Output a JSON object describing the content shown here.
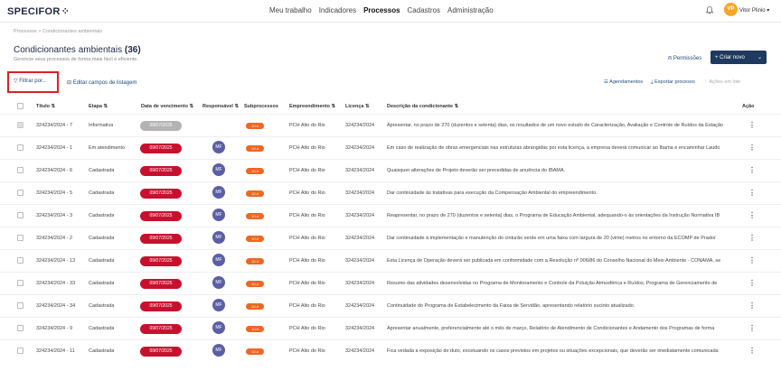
{
  "app": {
    "logo": "SPECIFOR",
    "logo_mark": "⁘"
  },
  "nav": {
    "items": [
      "Meu trabalho",
      "Indicadores",
      "Processos",
      "Cadastros",
      "Administração"
    ],
    "active": "Processos"
  },
  "user": {
    "initials": "VP",
    "name": "Vitor Plinio",
    "chevron": "▾",
    "bell_icon": "bell-icon"
  },
  "breadcrumb": "Processos  >  Condicionantes ambientais",
  "page": {
    "title": "Condicionantes ambientais",
    "count": "(36)",
    "subtitle": "Gerencie seus processos de forma mais fácil e eficiente."
  },
  "actions": {
    "permissions": "Permissões",
    "new_button": "+  Criar novo",
    "new_chevron": "⌄",
    "filter": "Filtrar por...",
    "edit_columns": "Editar campos de listagem",
    "schedules": "Agendamentos",
    "export": "Exportar processo",
    "bulk": "Ações em lote"
  },
  "columns": {
    "title": "Título",
    "stage": "Etapa",
    "due": "Data de vencimento",
    "responsible": "Responsável",
    "subprocesses": "Subprocessos",
    "project": "Empreendimento",
    "license": "Licença",
    "description": "Descrição da condicionante",
    "action": "Ação"
  },
  "sort_icon": "⇅",
  "rows": [
    {
      "title": "324234/2024 - 7",
      "stage": "Informativa",
      "date": "09/07/2025",
      "avatar": "",
      "sub": "10 d",
      "project": "PCH Alto do Rio",
      "license": "324234/2024",
      "desc": "Apresentar, no prazo de 270 (duzentos e setenta) dias, os resultados de um novo estudo de Caracterização, Avaliação e Controle de Ruídos da Estação"
    },
    {
      "title": "324234/2024 - 1",
      "stage": "Em atendimento",
      "date": "09/07/2025",
      "avatar": "MF",
      "sub": "10 d",
      "project": "PCH Alto do Rio",
      "license": "324234/2024",
      "desc": "Em caso de realização de obras emergenciais nas estruturas abrangidas por esta licença, a empresa deverá comunicar ao Ibama e encaminhar Laudo"
    },
    {
      "title": "324234/2024 - 6",
      "stage": "Cadastrada",
      "date": "09/07/2025",
      "avatar": "MF",
      "sub": "10 d",
      "project": "PCH Alto do Rio",
      "license": "324234/2024",
      "desc": "Quaisquer alterações de Projeto deverão ser precedidas de anuência do IBAMA."
    },
    {
      "title": "324234/2024 - 5",
      "stage": "Cadastrada",
      "date": "09/07/2025",
      "avatar": "MF",
      "sub": "10 d",
      "project": "PCH Alto do Rio",
      "license": "324234/2024",
      "desc": "Dar continuidade às tratativas para execução da Compensação Ambiental do empreendimento."
    },
    {
      "title": "324234/2024 - 3",
      "stage": "Cadastrada",
      "date": "09/07/2025",
      "avatar": "MF",
      "sub": "10 d",
      "project": "PCH Alto do Rio",
      "license": "324234/2024",
      "desc": "Reapresentar, no prazo de 270 (duzentos e setenta) dias, o Programa de Educação Ambiental, adequando-o às orientações da Instrução Normativa IB"
    },
    {
      "title": "324234/2024 - 2",
      "stage": "Cadastrada",
      "date": "09/07/2025",
      "avatar": "MF",
      "sub": "10 d",
      "project": "PCH Alto do Rio",
      "license": "324234/2024",
      "desc": "Dar continuidade à implementação e manutenção do cinturão verde em uma faixa com largura de 20 (vinte) metros no entorno da ECOMP de Prado/"
    },
    {
      "title": "324234/2024 - 13",
      "stage": "Cadastrada",
      "date": "09/07/2025",
      "avatar": "MF",
      "sub": "10 d",
      "project": "PCH Alto do Rio",
      "license": "324234/2024",
      "desc": "Esta Licença de Operação deverá ser publicada em conformidade com a Resolução nº 006/86 do Conselho Nacional do Meio Ambiente - CONAMA, se"
    },
    {
      "title": "324234/2024 - 33",
      "stage": "Cadastrada",
      "date": "09/07/2025",
      "avatar": "MF",
      "sub": "10 d",
      "project": "PCH Alto do Rio",
      "license": "324234/2024",
      "desc": "Resumo das atividades desenvolvidas no Programa de Monitoramento e Controle da Poluição Atmosférica e Ruídos, Programa de Gerenciamento de"
    },
    {
      "title": "324234/2024 - 34",
      "stage": "Cadastrada",
      "date": "09/07/2025",
      "avatar": "MF",
      "sub": "10 d",
      "project": "PCH Alto do Rio",
      "license": "324234/2024",
      "desc": "Continuidade do Programa de Estabelecimento da Faixa de Servidão, apresentando relatório sucinto atualizado."
    },
    {
      "title": "324234/2024 - 9",
      "stage": "Cadastrada",
      "date": "09/07/2025",
      "avatar": "MF",
      "sub": "10 d",
      "project": "PCH Alto do Rio",
      "license": "324234/2024",
      "desc": "Apresentar anualmente, preferencialmente até o mês de março, Relatório de Atendimento de Condicionantes e Andamento dos Programas de forma"
    },
    {
      "title": "324234/2024 - 11",
      "stage": "Cadastrada",
      "date": "09/07/2025",
      "avatar": "MF",
      "sub": "10 d",
      "project": "PCH Alto do Rio",
      "license": "324234/2024",
      "desc": "Fica vedada a exposição do duto, excetuando os casos previstos em projetos ou situações excepcionais, que deverão ser imediatamente comunicada"
    }
  ]
}
